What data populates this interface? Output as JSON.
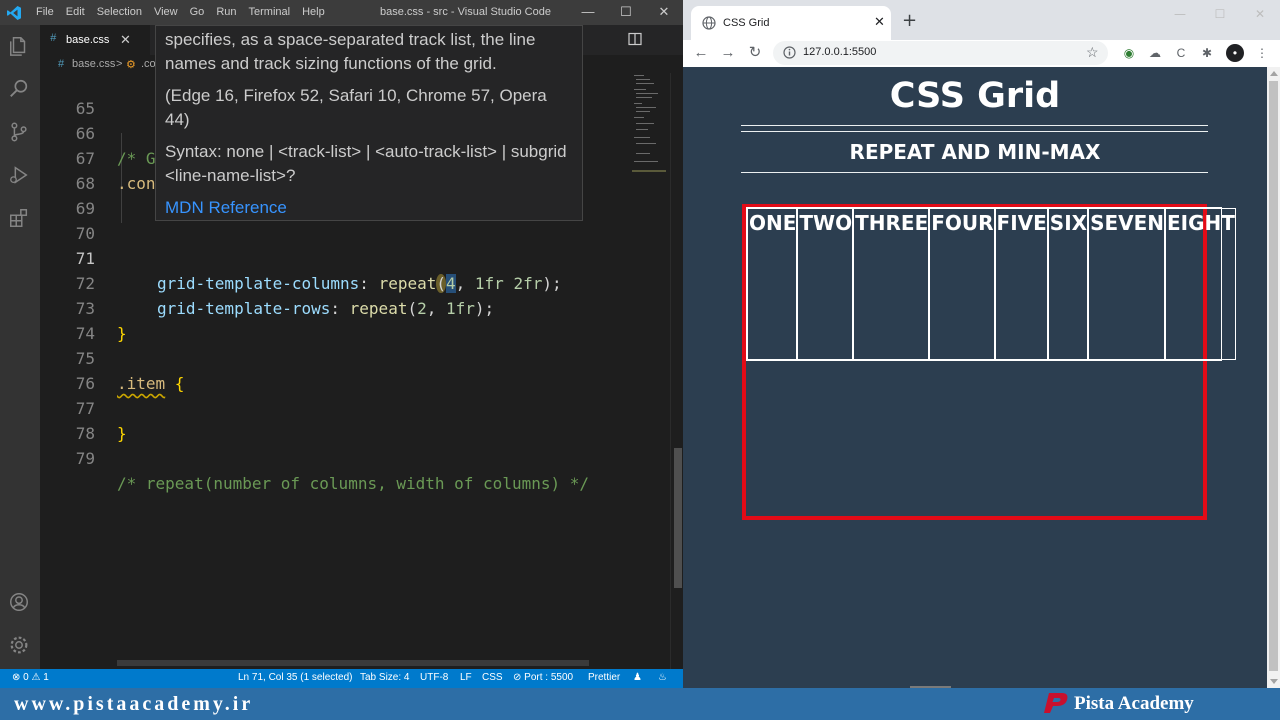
{
  "vscode": {
    "menu": [
      "File",
      "Edit",
      "Selection",
      "View",
      "Go",
      "Run",
      "Terminal",
      "Help"
    ],
    "window_title": "base.css - src - Visual Studio Code",
    "window_controls": [
      "—",
      "☐",
      "✕"
    ],
    "tab": {
      "icon": "#",
      "label": "base.css",
      "close": "✕"
    },
    "breadcrumbs": {
      "file": "base.css",
      "sep": ">",
      "symbol": ".co"
    },
    "lines": [
      {
        "n": "65"
      },
      {
        "n": "66",
        "comment": "/* G"
      },
      {
        "n": "67",
        "selector": ".con"
      },
      {
        "n": "68"
      },
      {
        "n": "69"
      },
      {
        "n": "70"
      },
      {
        "n": "71",
        "prop": "grid-template-columns",
        "colon": ": ",
        "fn": "repeat",
        "open": "(",
        "num1": "4",
        "comma": ", ",
        "val": "1fr 2fr",
        "close": ");"
      },
      {
        "n": "72",
        "prop": "grid-template-rows",
        "colon": ": ",
        "fn": "repeat",
        "open": "(",
        "num1": "2",
        "comma": ", ",
        "val": "1fr",
        "close": ");"
      },
      {
        "n": "73",
        "brace": "}"
      },
      {
        "n": "74"
      },
      {
        "n": "75",
        "selector": ".item",
        "rest": " {"
      },
      {
        "n": "76"
      },
      {
        "n": "77",
        "brace": "}"
      },
      {
        "n": "78"
      },
      {
        "n": "79",
        "comment": "/* repeat(number of columns, width of columns) */"
      }
    ],
    "hover": {
      "description": "specifies, as a space-separated track list, the line names and track sizing functions of the grid.",
      "browsers": "(Edge 16, Firefox 52, Safari 10, Chrome 57, Opera 44)",
      "syntax": "Syntax: none | <track-list> | <auto-track-list> | subgrid <line-name-list>?",
      "link": "MDN Reference"
    },
    "status": {
      "problems": "⊗ 0 ⚠ 1",
      "position": "Ln 71, Col 35 (1 selected)",
      "tab_size": "Tab Size: 4",
      "encoding": "UTF-8",
      "eol": "LF",
      "language": "CSS",
      "port": "⊘ Port : 5500",
      "formatter": "Prettier"
    }
  },
  "browser": {
    "tab_title": "CSS Grid",
    "tab_close": "✕",
    "new_tab": "+",
    "url": "127.0.0.1:5500",
    "page": {
      "title": "CSS Grid",
      "subtitle": "REPEAT AND MIN-MAX",
      "items": [
        "ONE",
        "TWO",
        "THREE",
        "FOUR",
        "FIVE",
        "SIX",
        "SEVEN",
        "EIGHT"
      ]
    }
  },
  "watermark": {
    "url": "www.pistaacademy.ir",
    "name": "Pista Academy"
  },
  "colors": {
    "vscode_status": "#007acc",
    "page_bg": "#2c3e50",
    "container_border": "#e30b17",
    "watermark_bar": "#2d6ea6"
  }
}
